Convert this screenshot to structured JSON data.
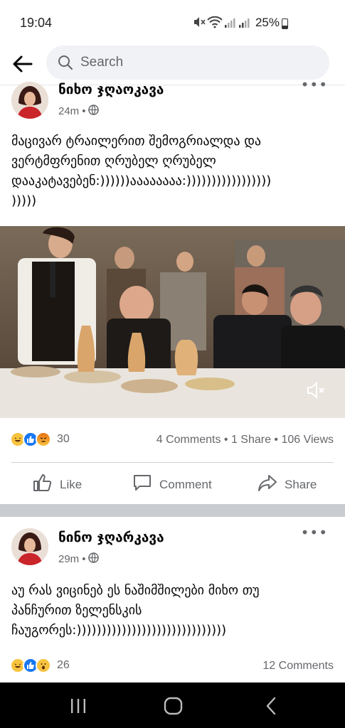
{
  "status": {
    "time": "19:04",
    "battery": "25%"
  },
  "search": {
    "placeholder": "Search"
  },
  "post1": {
    "author": "ნიხო ჯღაოკავა",
    "time": "24m",
    "text_lines": [
      "მაცივარ ტრაილერით შემოგრიალდა და",
      "ვერტმფრენით ღრუბელ ღრუბელ",
      "დააკატავებენ:))))))აააააააა:)))))))))))))))))",
      ")))))"
    ],
    "reaction_count": "30",
    "stats": "4 Comments • 1 Share • 106 Views"
  },
  "actions": {
    "like": "Like",
    "comment": "Comment",
    "share": "Share"
  },
  "post2": {
    "author": "ნინო ჯღარკავა",
    "time": "29m",
    "text_lines": [
      "აუ რას ვიცინებ ეს ნაშიმშილები მიხო თუ",
      "პანჩურით  ზელენსკის",
      "ჩაუგორეს:))))))))))))))))))))))))))))))"
    ],
    "reaction_count": "26",
    "stats": "12 Comments"
  },
  "colors": {
    "accent": "#1877f2",
    "separator": "#c9ccd1",
    "secondary_text": "#65676b"
  }
}
